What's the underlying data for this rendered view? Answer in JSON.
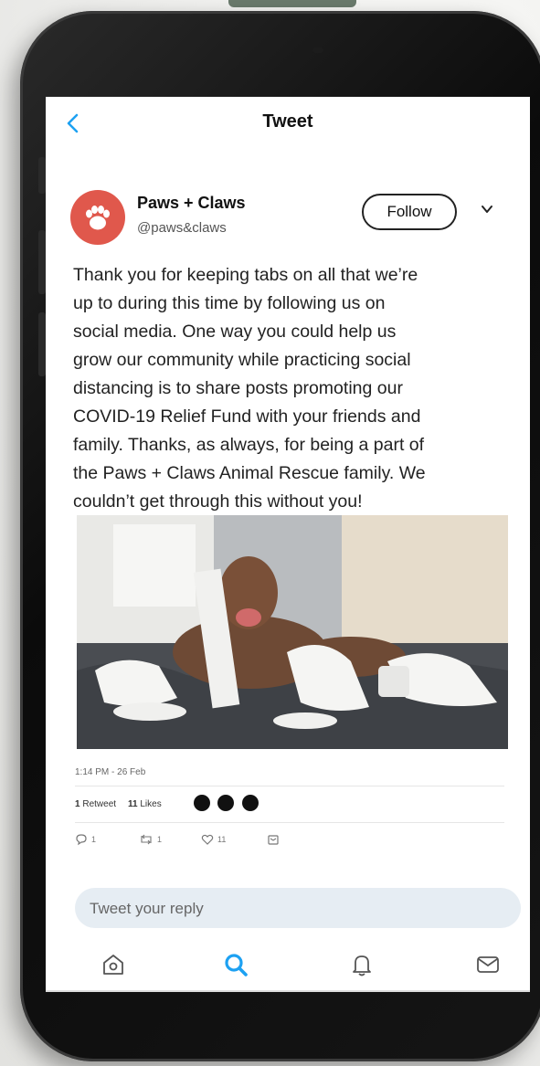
{
  "header": {
    "title": "Tweet",
    "back_icon": "chevron-left-icon"
  },
  "tweet": {
    "display_name": "Paws + Claws",
    "handle": "@paws&claws",
    "follow_label": "Follow",
    "lines": [
      "Thank you for keeping tabs on all that we’re",
      "up to during this time by following us on",
      "social media. One way you could help us",
      "grow our community while practicing social",
      "distancing is to share posts promoting our",
      "COVID-19 Relief Fund with your friends and",
      "family. Thanks, as always, for being a part of",
      "the Paws + Claws Animal Rescue family. We",
      "couldn’t get through this without you!"
    ],
    "timestamp": "1:14 PM - 26 Feb",
    "stats": {
      "retweets": "1",
      "retweets_label": "Retweet",
      "likes": "11",
      "likes_label": "Likes"
    },
    "actions": {
      "reply_count": "1",
      "retweet_count": "1",
      "like_count": "11"
    }
  },
  "reply": {
    "placeholder": "Tweet your reply"
  },
  "tabbar": {
    "items": [
      "home-icon",
      "search-icon",
      "notifications-icon",
      "messages-icon"
    ]
  },
  "colors": {
    "accent": "#1da1f2",
    "avatar_bg": "#e0584c",
    "reply_bg": "#e6edf3"
  }
}
